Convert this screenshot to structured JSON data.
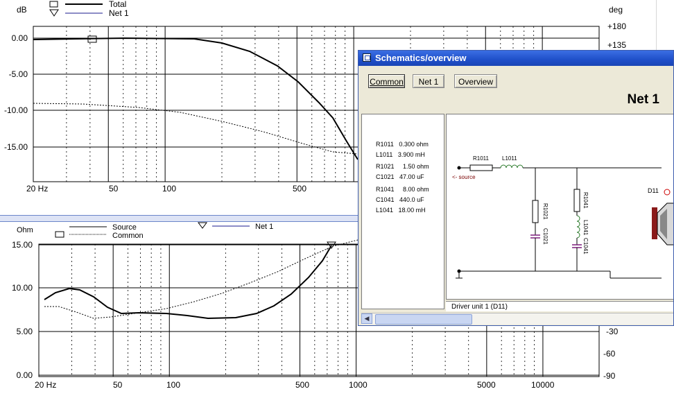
{
  "top_chart": {
    "y_unit": "dB",
    "y2_unit": "deg",
    "y_ticks": [
      "0.00",
      "-5.00",
      "-10.00",
      "-15.00"
    ],
    "y2_ticks": [
      "+180",
      "+135"
    ],
    "x_ticks": [
      "20 Hz",
      "50",
      "100",
      "500"
    ],
    "legend": [
      {
        "label": "Total",
        "style": "solid"
      },
      {
        "label": "Net 1",
        "style": "solid-blue"
      }
    ]
  },
  "bottom_chart": {
    "y_unit": "Ohm",
    "y_ticks": [
      "15.00",
      "10.00",
      "5.00",
      "0.00"
    ],
    "y2_ticks": [
      "-30",
      "-60",
      "-90"
    ],
    "x_ticks": [
      "20 Hz",
      "50",
      "100",
      "500",
      "1000",
      "5000",
      "10000"
    ],
    "legend": [
      {
        "label": "Source",
        "style": "solid"
      },
      {
        "label": "Common",
        "style": "dotted"
      },
      {
        "label": "Net 1",
        "style": "solid-blue"
      }
    ]
  },
  "schematic_window": {
    "title": "Schematics/overview",
    "buttons": [
      "Common",
      "Net 1",
      "Overview"
    ],
    "heading": "Net 1",
    "components": [
      [
        "R1011",
        "0.300 ohm"
      ],
      [
        "L1011",
        "3.900 mH"
      ],
      [
        "R1021",
        "1.50 ohm"
      ],
      [
        "C1021",
        "47.00 uF"
      ],
      [
        "R1041",
        "8.00 ohm"
      ],
      [
        "C1041",
        "440.0 uF"
      ],
      [
        "L1041",
        "18.00 mH"
      ]
    ],
    "diagram": {
      "r1011": "R1011",
      "l1011": "L1011",
      "source": "<- source",
      "r1021": "R1021",
      "c1021": "C1021",
      "r1041": "R1041",
      "l1041": "L1041",
      "c1041": "C1041",
      "driver": "D11"
    },
    "status": "Driver unit 1 (D11)"
  },
  "colors": {
    "titlebar": "#2355d3",
    "net_line": "#1a1a8c",
    "window_bg": "#ece9d8"
  }
}
